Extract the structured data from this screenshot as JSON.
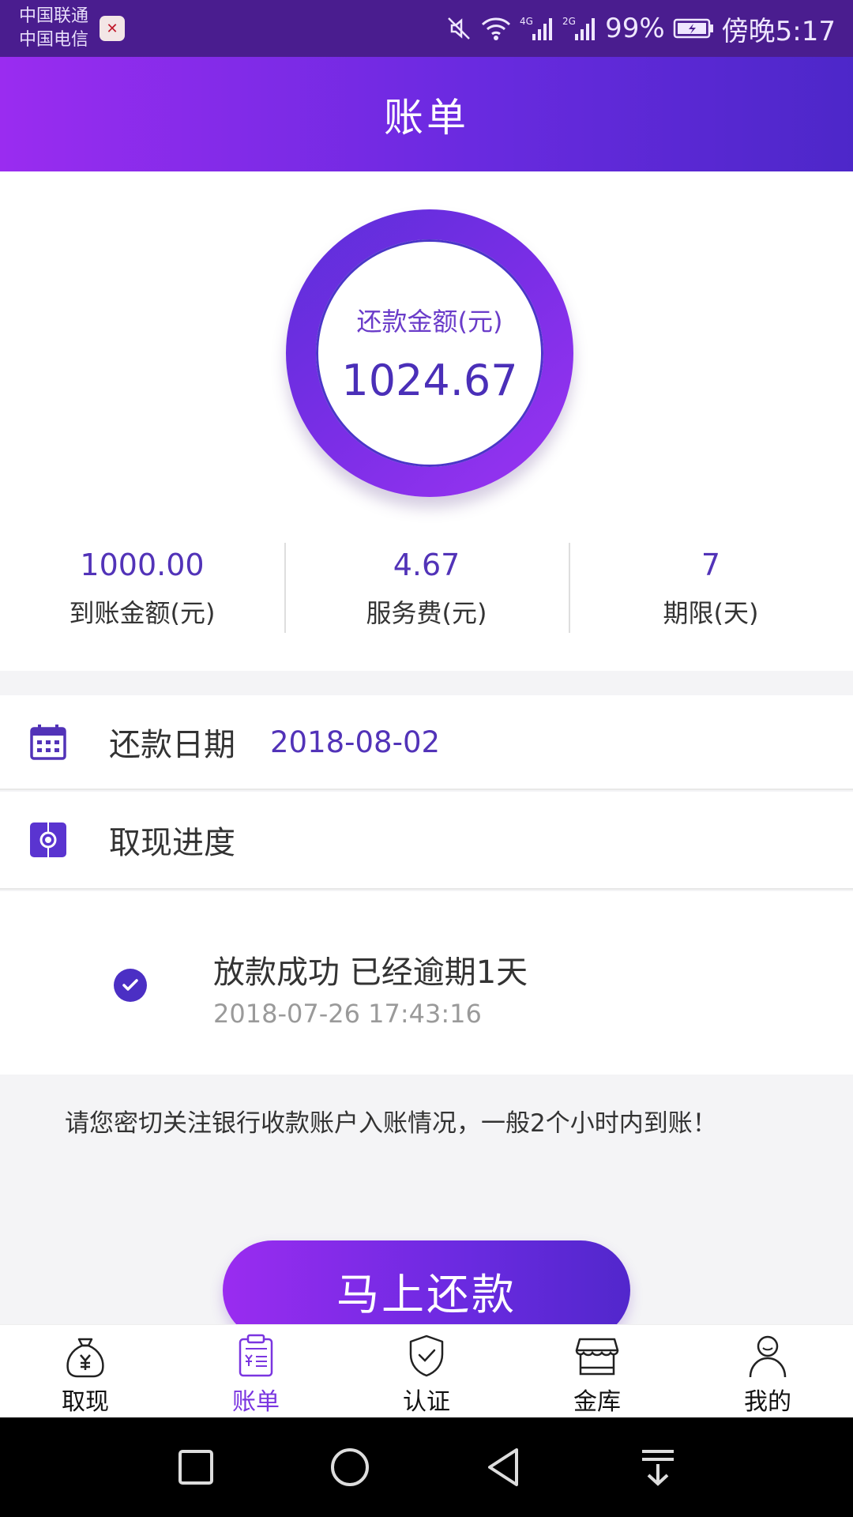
{
  "status_bar": {
    "carrier_1": "中国联通",
    "carrier_2": "中国电信",
    "battery": "99%",
    "time": "傍晚5:17",
    "network_1": "4G",
    "network_2": "2G"
  },
  "header": {
    "title": "账单"
  },
  "summary": {
    "ring_label": "还款金额(元)",
    "ring_value": "1024.67",
    "stats": [
      {
        "value": "1000.00",
        "label": "到账金额(元)"
      },
      {
        "value": "4.67",
        "label": "服务费(元)"
      },
      {
        "value": "7",
        "label": "期限(天)"
      }
    ]
  },
  "repay_date": {
    "label": "还款日期",
    "value": "2018-08-02"
  },
  "progress": {
    "label": "取现进度",
    "items": [
      {
        "title": "放款成功 已经逾期1天",
        "time": "2018-07-26 17:43:16"
      }
    ]
  },
  "notice": "请您密切关注银行收款账户入账情况，一般2个小时内到账！",
  "repay_button": "马上还款",
  "tabs": [
    {
      "label": "取现",
      "icon": "money-bag-icon",
      "active": false
    },
    {
      "label": "账单",
      "icon": "bill-icon",
      "active": true
    },
    {
      "label": "认证",
      "icon": "shield-check-icon",
      "active": false
    },
    {
      "label": "金库",
      "icon": "store-icon",
      "active": false
    },
    {
      "label": "我的",
      "icon": "user-icon",
      "active": false
    }
  ],
  "colors": {
    "accent": "#6a2ae0",
    "gradient_start": "#9a2cf0",
    "gradient_end": "#4d27c9",
    "value_text": "#5233b8"
  }
}
